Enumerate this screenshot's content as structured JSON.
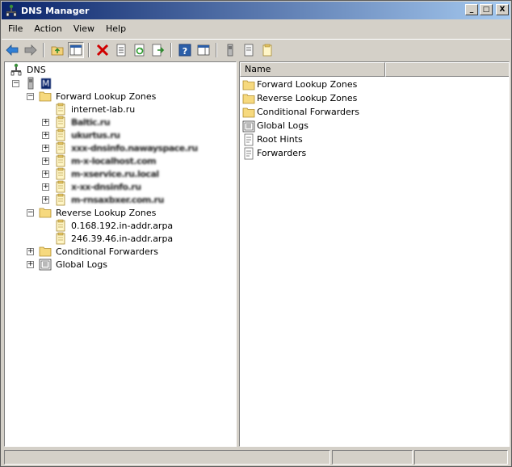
{
  "window": {
    "title": "DNS Manager"
  },
  "titlebar": {
    "minimize": "_",
    "maximize": "□",
    "close": "X"
  },
  "menu": [
    "File",
    "Action",
    "View",
    "Help"
  ],
  "tree": {
    "root": "DNS",
    "server": "M",
    "forward_zones": "Forward Lookup Zones",
    "forward_children": [
      "internet-lab.ru",
      "Baltic.ru",
      "ukurtus.ru",
      "xxx-dnsinfo.nawayspace.ru",
      "m-x-localhost.com",
      "m-xservice.ru.local",
      "x-xx-dnsinfo.ru",
      "m-rnsaxbxer.com.ru"
    ],
    "reverse_zones": "Reverse Lookup Zones",
    "reverse_children": [
      "0.168.192.in-addr.arpa",
      "246.39.46.in-addr.arpa"
    ],
    "conditional_forwarders": "Conditional Forwarders",
    "global_logs": "Global Logs"
  },
  "list": {
    "column_name": "Name",
    "items": [
      {
        "label": "Forward Lookup Zones",
        "icon": "folder-icon"
      },
      {
        "label": "Reverse Lookup Zones",
        "icon": "folder-icon"
      },
      {
        "label": "Conditional Forwarders",
        "icon": "folder-icon"
      },
      {
        "label": "Global Logs",
        "icon": "log-icon"
      },
      {
        "label": "Root Hints",
        "icon": "properties-icon"
      },
      {
        "label": "Forwarders",
        "icon": "properties-icon"
      }
    ]
  },
  "colors": {
    "title_start": "#0a246a",
    "title_end": "#a6caf0",
    "chrome": "#d4d0c8",
    "delete": "#d00000"
  }
}
